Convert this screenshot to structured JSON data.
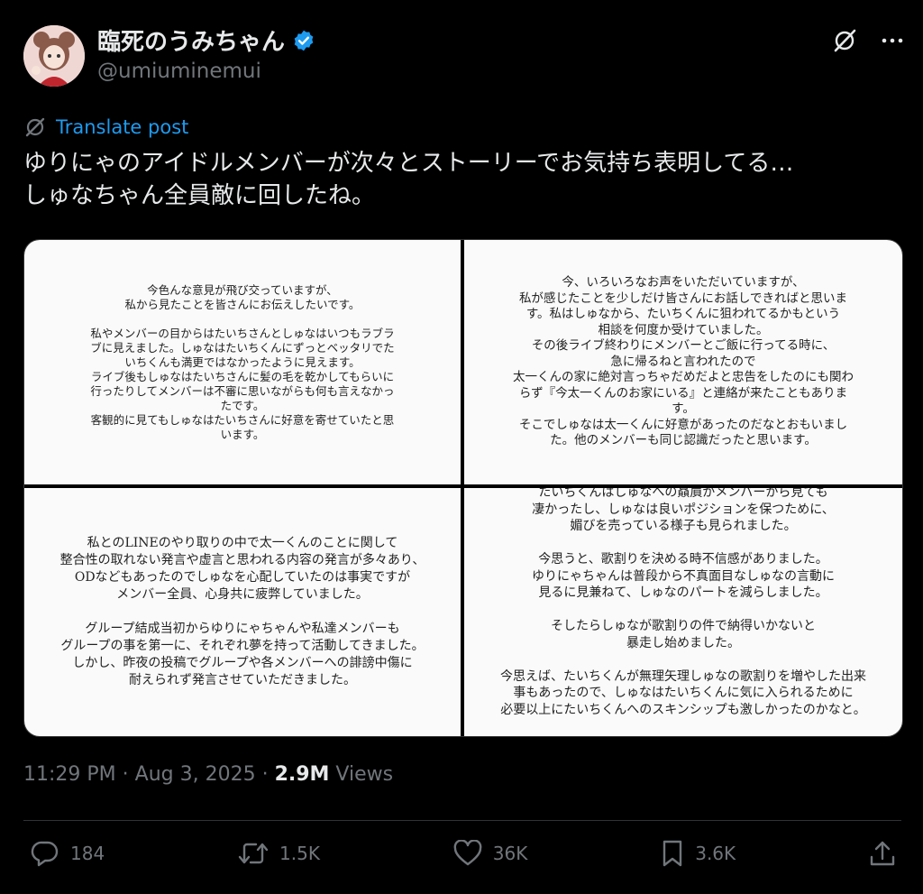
{
  "author": {
    "name": "臨死のうみちゃん",
    "handle": "@umiuminemui",
    "verified": true
  },
  "translate_label": "Translate post",
  "post_text": "ゆりにゃのアイドルメンバーが次々とストーリーでお気持ち表明してる…\nしゅなちゃん全員敵に回したね。",
  "images": [
    {
      "text": "今色んな意見が飛び交っていますが、\n私から見たことを皆さんにお伝えしたいです。\n\n私やメンバーの目からはたいちさんとしゅなはいつもラブラ\nブに見えました。しゅなはたいちくんにずっとベッタリでた\nいちくんも満更ではなかったように見えます。\nライブ後もしゅなはたいちさんに髪の毛を乾かしてもらいに\n行ったりしてメンバーは不審に思いながらも何も言えなかっ\nたです。\n客観的に見てもしゅなはたいちさんに好意を寄せていたと思\nいます。"
    },
    {
      "text": "今、いろいろなお声をいただいていますが、\n私が感じたことを少しだけ皆さんにお話しできればと思いま\nす。私はしゅなから、たいちくんに狙われてるかもという\n相談を何度か受けていました。\nその後ライブ終わりにメンバーとご飯に行ってる時に、\n急に帰るねと言われたので\n太一くんの家に絶対言っちゃだめだよと忠告をしたのにも関わ\nらず『今太一くんのお家にいる』と連絡が来たこともありま\nす。\nそこでしゅなは太一くんに好意があったのだなとおもいまし\nた。他のメンバーも同じ認識だったと思います。"
    },
    {
      "text": "私とのLINEのやり取りの中で太一くんのことに関して\n整合性の取れない発言や虚言と思われる内容の発言が多々あり、\nODなどもあったのでしゅなを心配していたのは事実ですが\nメンバー全員、心身共に疲弊していました。\n\nグループ結成当初からゆりにゃちゃんや私達メンバーも\nグループの事を第一に、それぞれ夢を持って活動してきました。\nしかし、昨夜の投稿でグループや各メンバーへの誹謗中傷に\n耐えられず発言させていただきました。"
    },
    {
      "text": "たいちくんはしゅなへの贔屓がメンバーから見ても\n凄かったし、しゅなは良いポジションを保つために、\n媚びを売っている様子も見られました。\n\n今思うと、歌割りを決める時不信感がありました。\nゆりにゃちゃんは普段から不真面目なしゅなの言動に\n見るに見兼ねて、しゅなのパートを減らしました。\n\nそしたらしゅなが歌割りの件で納得いかないと\n暴走し始めました。\n\n今思えば、たいちくんが無理矢理しゅなの歌割りを増やした出来\n事もあったので、しゅなはたいちくんに気に入られるために\n必要以上にたいちくんへのスキンシップも激しかったのかなと。\n\nメンバーは枕営業を疑っていたほどなので、"
    }
  ],
  "meta": {
    "time": "11:29 PM",
    "sep1": " · ",
    "date": "Aug 3, 2025",
    "sep2": " · ",
    "views_count": "2.9M",
    "views_label": " Views"
  },
  "actions": {
    "replies": "184",
    "reposts": "1.5K",
    "likes": "36K",
    "bookmarks": "3.6K"
  },
  "colors": {
    "accent": "#1d9bf0",
    "muted": "#71767b",
    "text": "#e7e9ea",
    "background": "#000000"
  },
  "icons": [
    "grok-icon",
    "more-icon",
    "translate-icon",
    "verified-badge-icon",
    "reply-icon",
    "repost-icon",
    "like-icon",
    "bookmark-icon",
    "share-icon"
  ]
}
